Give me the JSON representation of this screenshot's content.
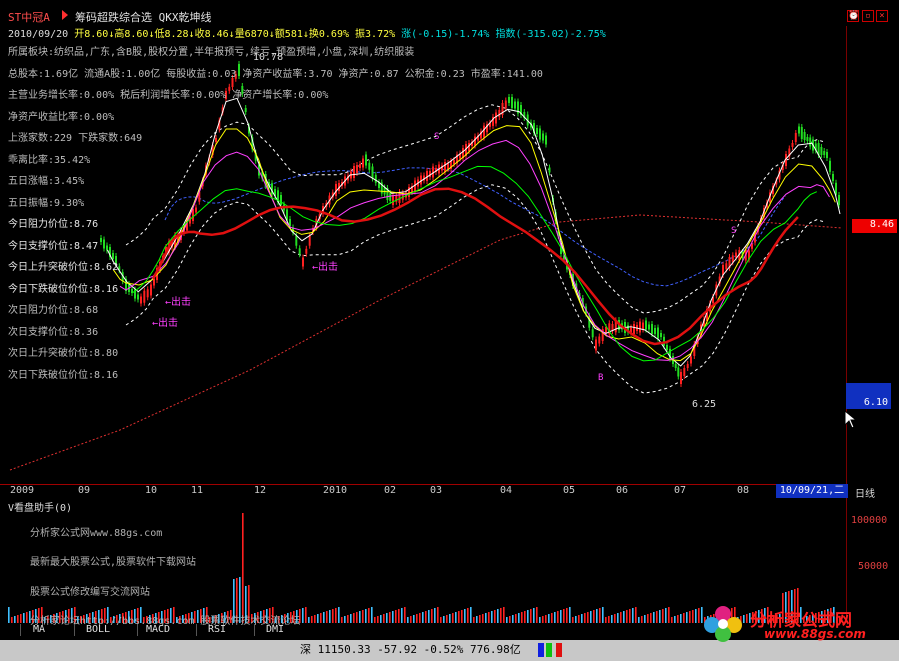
{
  "header": {
    "stock_name": "ST中冠A",
    "strategy": "筹码超跌综合选 QKX乾坤线"
  },
  "quote": {
    "date": "2010/09/20",
    "open": "开8.60↓",
    "high": "高8.60↓",
    "low": "低8.28↓",
    "close": "收8.46↓",
    "volume": "量6870↓",
    "amount": "额581↓",
    "turnover": "换0.69%",
    "amplitude": "振3.72%",
    "change": "涨(-0.15)-1.74%",
    "index": "指数(-315.02)-2.75%"
  },
  "fundamentals": {
    "sector": "所属板块:纺织品,广东,含B股,股权分置,半年报预亏,续亏,预盈预增,小盘,深圳,纺织服装",
    "capital": "总股本:1.69亿 流通A股:1.00亿 每股收益:0.03 净资产收益率:3.70 净资产:0.87 公积金:0.23 市盈率:141.00",
    "growth": "主营业务增长率:0.00% 税后利润增长率:0.00% 净资产增长率:0.00%",
    "roe": "净资产收益比率:0.00%",
    "up_count": "上涨家数:229  下跌家数:649",
    "ma5_bias": "乖离比率:35.42%",
    "day5_up": "五日涨幅:3.45%",
    "day5_range": "五日振幅:9.30%"
  },
  "levels": {
    "today_resist": "今日阻力价位:8.76",
    "today_support": "今日支撑价位:8.47",
    "today_break_up": "今日上升突破价位:8.62",
    "today_break_down": "今日下跌破位价位:8.16",
    "next_resist": "次日阻力价位:8.68",
    "next_support": "次日支撑价位:8.36",
    "next_break_up": "次日上升突破价位:8.80",
    "next_break_down": "次日下跌破位价位:8.16"
  },
  "annotations": {
    "signal_exit": "←出击",
    "high_label": "10.78",
    "low_label": "6.25",
    "s_mark": "S",
    "b_mark": "B"
  },
  "price_axis": {
    "current_price": "8.46",
    "cursor_price": "6.10"
  },
  "dates": {
    "d2009": "2009",
    "m09": "09",
    "m10": "10",
    "m11": "11",
    "m12": "12",
    "d2010": "2010",
    "m02": "02",
    "m03": "03",
    "m04": "04",
    "m05": "05",
    "m06": "06",
    "m07": "07",
    "m08": "08",
    "cursor": "10/09/21,二",
    "period": "日线"
  },
  "volume_panel": {
    "title": "V看盘助手(0)",
    "axis_top": "100000",
    "axis_mid": "50000",
    "ad1": "分析家公式网www.88gs.com",
    "ad2": "最新最大股票公式,股票软件下载网站",
    "ad3": "股票公式修改编写交流网站",
    "ad4": "分析家论坛http://bbs.88gs.com 股票软件技术交流论坛"
  },
  "tabs": [
    "MA",
    "BOLL",
    "MACD",
    "RSI",
    "DMI"
  ],
  "status": {
    "market": "深",
    "index_value": "11150.33",
    "change": "-57.92",
    "pct": "-0.52%",
    "amount": "776.98亿"
  },
  "logo": {
    "name": "分析家公式网",
    "url": "www.88gs.com"
  },
  "colors": {
    "up": "#ff2020",
    "down": "#22dd22",
    "ma_white": "#ffffff",
    "ma_yellow": "#ffff00",
    "ma_magenta": "#ff40ff",
    "ma_green": "#00ff00",
    "ma_red": "#e01010",
    "ma_blue": "#3050ff"
  }
}
